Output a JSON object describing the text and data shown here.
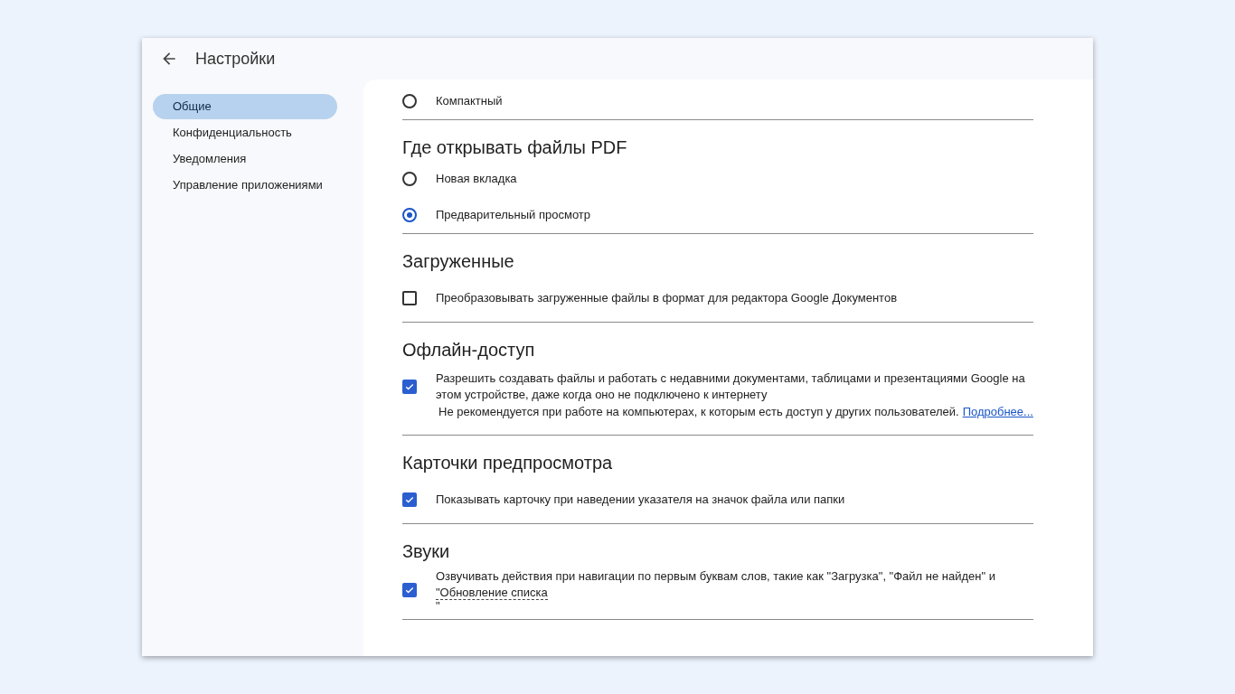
{
  "window": {
    "title": "Настройки"
  },
  "sidebar": {
    "items": [
      {
        "label": "Общие",
        "selected": true
      },
      {
        "label": "Конфиденциальность",
        "selected": false
      },
      {
        "label": "Уведомления",
        "selected": false
      },
      {
        "label": "Управление приложениями",
        "selected": false
      }
    ]
  },
  "sections": [
    {
      "options": [
        {
          "kind": "radio",
          "label": "Компактный",
          "selected": false
        }
      ]
    },
    {
      "title": "Где открывать файлы PDF",
      "options": [
        {
          "kind": "radio",
          "label": "Новая вкладка",
          "selected": false
        },
        {
          "kind": "radio",
          "label": "Предварительный просмотр",
          "selected": true
        }
      ]
    },
    {
      "title": "Загруженные",
      "options": [
        {
          "kind": "checkbox",
          "label": "Преобразовывать загруженные файлы в формат для редактора Google Документов",
          "checked": false
        }
      ]
    },
    {
      "title": "Офлайн-доступ",
      "options": [
        {
          "kind": "checkbox",
          "label": "Разрешить создавать файлы и работать с недавними документами, таблицами и презентациями Google на этом устройстве, даже когда оно не подключено к интернету",
          "checked": true,
          "note": "Не рекомендуется при работе на компьютерах, к которым есть доступ у других пользователей.",
          "link": "Подробнее..."
        }
      ]
    },
    {
      "title": "Карточки предпросмотра",
      "options": [
        {
          "kind": "checkbox",
          "label": "Показывать карточку при наведении указателя на значок файла или папки",
          "checked": true
        }
      ]
    },
    {
      "title": "Звуки",
      "options": [
        {
          "kind": "checkbox",
          "label": "Озвучивать действия при навигации по первым буквам слов, такие как \"Загрузка\", \"Файл не найден\" и",
          "term": "\"Обновление списка",
          "tail": "\"",
          "checked": true
        }
      ]
    }
  ]
}
